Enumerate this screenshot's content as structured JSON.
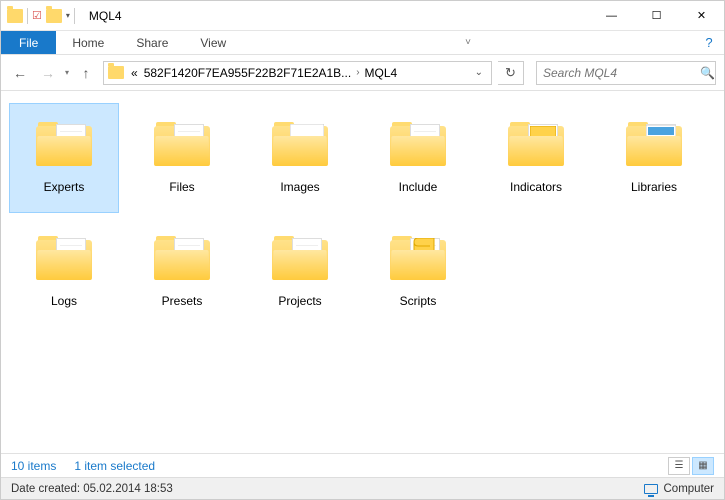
{
  "window": {
    "title": "MQL4",
    "controls": {
      "min": "—",
      "max": "☐",
      "close": "✕"
    }
  },
  "ribbon": {
    "file": "File",
    "tabs": [
      "Home",
      "Share",
      "View"
    ]
  },
  "nav": {
    "address_prefix": "«",
    "address_folder": "582F1420F7EA955F22B2F71E2A1B...",
    "address_current": "MQL4",
    "search_placeholder": "Search MQL4"
  },
  "items": [
    {
      "label": "Experts",
      "selected": true,
      "overlay": ""
    },
    {
      "label": "Files",
      "selected": false,
      "overlay": ""
    },
    {
      "label": "Images",
      "selected": false,
      "overlay": "img"
    },
    {
      "label": "Include",
      "selected": false,
      "overlay": ""
    },
    {
      "label": "Indicators",
      "selected": false,
      "overlay": "ƒ"
    },
    {
      "label": "Libraries",
      "selected": false,
      "overlay": "lib"
    },
    {
      "label": "Logs",
      "selected": false,
      "overlay": ""
    },
    {
      "label": "Presets",
      "selected": false,
      "overlay": ""
    },
    {
      "label": "Projects",
      "selected": false,
      "overlay": ""
    },
    {
      "label": "Scripts",
      "selected": false,
      "overlay": "scr"
    }
  ],
  "status": {
    "count": "10 items",
    "selected": "1 item selected"
  },
  "detail": {
    "created": "Date created: 05.02.2014 18:53",
    "location": "Computer"
  }
}
